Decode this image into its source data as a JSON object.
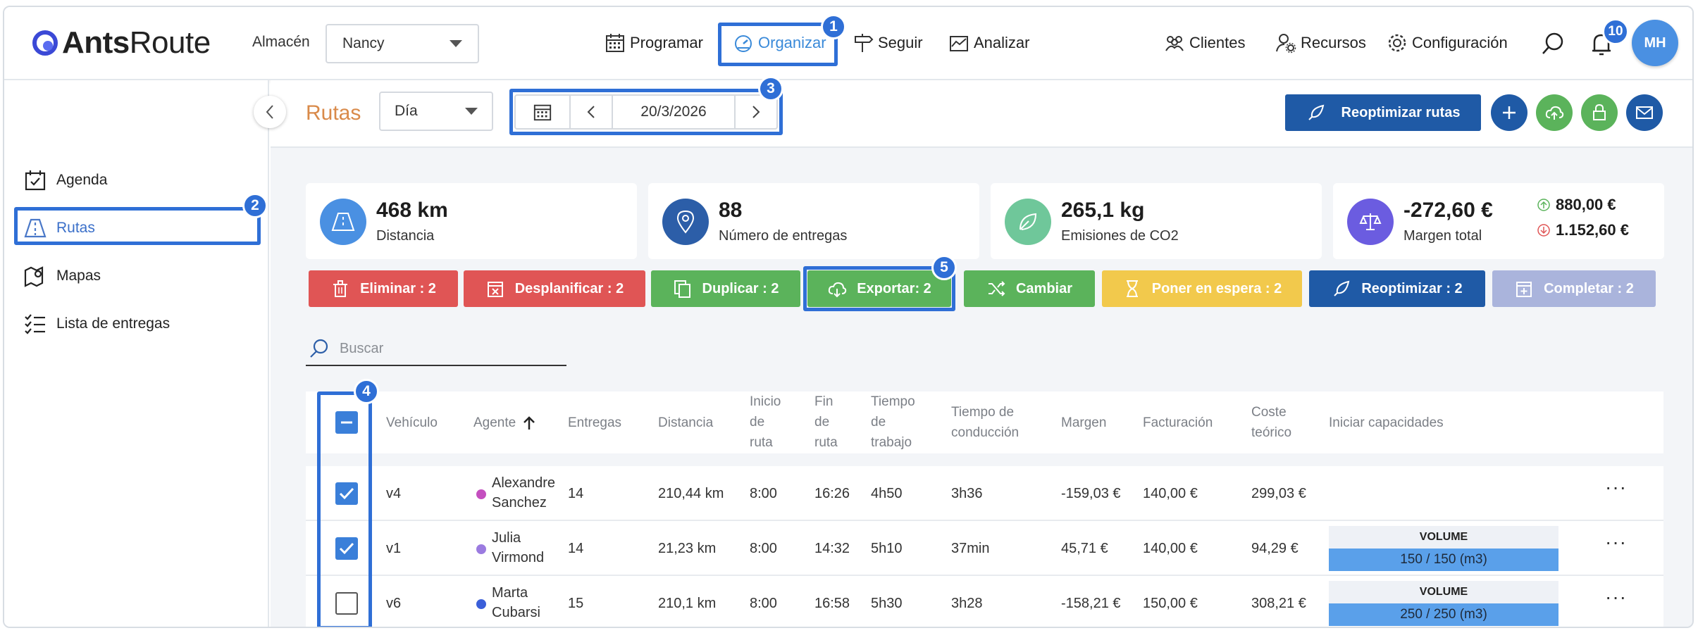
{
  "header": {
    "logo_bold": "Ants",
    "logo_light": "Route",
    "warehouse_label": "Almacén",
    "warehouse_value": "Nancy",
    "nav": [
      {
        "label": "Programar",
        "icon": "calendar-icon"
      },
      {
        "label": "Organizar",
        "icon": "speedometer-icon"
      },
      {
        "label": "Seguir",
        "icon": "signpost-icon"
      },
      {
        "label": "Analizar",
        "icon": "chart-icon"
      }
    ],
    "right_nav": [
      {
        "label": "Clientes",
        "icon": "users-icon"
      },
      {
        "label": "Recursos",
        "icon": "user-gear-icon"
      },
      {
        "label": "Configuración",
        "icon": "gear-icon"
      }
    ],
    "notifications_count": "10",
    "avatar_initials": "MH"
  },
  "sidebar": {
    "items": [
      {
        "label": "Agenda",
        "icon": "calendar-check-icon"
      },
      {
        "label": "Rutas",
        "icon": "road-icon"
      },
      {
        "label": "Mapas",
        "icon": "map-pin-icon"
      },
      {
        "label": "Lista de entregas",
        "icon": "checklist-icon"
      }
    ]
  },
  "toolbar": {
    "title": "Rutas",
    "period_value": "Día",
    "date_value": "20/3/2026",
    "reoptimize_label": "Reoptimizar rutas"
  },
  "stats": {
    "distance_value": "468 km",
    "distance_label": "Distancia",
    "deliveries_value": "88",
    "deliveries_label": "Número de entregas",
    "co2_value": "265,1 kg",
    "co2_label": "Emisiones de CO2",
    "margin_value": "-272,60 €",
    "margin_label": "Margen total",
    "margin_up": "880,00 €",
    "margin_down": "1.152,60 €"
  },
  "actions": {
    "delete": "Eliminar : 2",
    "unplan": "Desplanificar : 2",
    "duplicate": "Duplicar : 2",
    "export": "Exportar: 2",
    "change": "Cambiar",
    "hold": "Poner en espera : 2",
    "reoptimize": "Reoptimizar : 2",
    "complete": "Completar : 2"
  },
  "search": {
    "placeholder": "Buscar"
  },
  "table": {
    "headers": {
      "vehicle": "Vehículo",
      "agent": "Agente",
      "deliveries": "Entregas",
      "distance": "Distancia",
      "start_1": "Inicio",
      "start_2": "de",
      "start_3": "ruta",
      "end_1": "Fin",
      "end_2": "de",
      "end_3": "ruta",
      "work_1": "Tiempo",
      "work_2": "de",
      "work_3": "trabajo",
      "drive_1": "Tiempo de",
      "drive_2": "conducción",
      "margin": "Margen",
      "billing": "Facturación",
      "cost_1": "Coste",
      "cost_2": "teórico",
      "capacities": "Iniciar capacidades"
    },
    "rows": [
      {
        "vehicle": "v4",
        "agent_1": "Alexandre",
        "agent_2": "Sanchez",
        "agent_color": "#c44fbf",
        "deliveries": "14",
        "distance": "210,44 km",
        "start": "8:00",
        "end": "16:26",
        "work": "4h50",
        "drive": "3h36",
        "margin": "-159,03 €",
        "billing": "140,00 €",
        "cost": "299,03 €",
        "cap_title": "",
        "cap_value": "",
        "checked": true
      },
      {
        "vehicle": "v1",
        "agent_1": "Julia",
        "agent_2": "Virmond",
        "agent_color": "#9b7be0",
        "deliveries": "14",
        "distance": "21,23 km",
        "start": "8:00",
        "end": "14:32",
        "work": "5h10",
        "drive": "37min",
        "margin": "45,71 €",
        "billing": "140,00 €",
        "cost": "94,29 €",
        "cap_title": "VOLUME",
        "cap_value": "150 / 150 (m3)",
        "checked": true
      },
      {
        "vehicle": "v6",
        "agent_1": "Marta",
        "agent_2": "Cubarsi",
        "agent_color": "#3b5fd9",
        "deliveries": "15",
        "distance": "210,1 km",
        "start": "8:00",
        "end": "16:58",
        "work": "5h30",
        "drive": "3h28",
        "margin": "-158,21 €",
        "billing": "150,00 €",
        "cost": "308,21 €",
        "cap_title": "VOLUME",
        "cap_value": "250 / 250 (m3)",
        "checked": false
      }
    ]
  },
  "callouts": [
    "1",
    "2",
    "3",
    "4",
    "5"
  ],
  "colors": {
    "accent": "#2f6fd6",
    "title_orange": "#d98a4a",
    "delete": "#e05555",
    "unplan": "#e05555",
    "duplicate": "#5bb35b",
    "export": "#5bb35b",
    "change": "#5bb35b",
    "hold": "#f2c94c",
    "reoptimize": "#1f5aa6",
    "complete": "#aab4dc"
  }
}
